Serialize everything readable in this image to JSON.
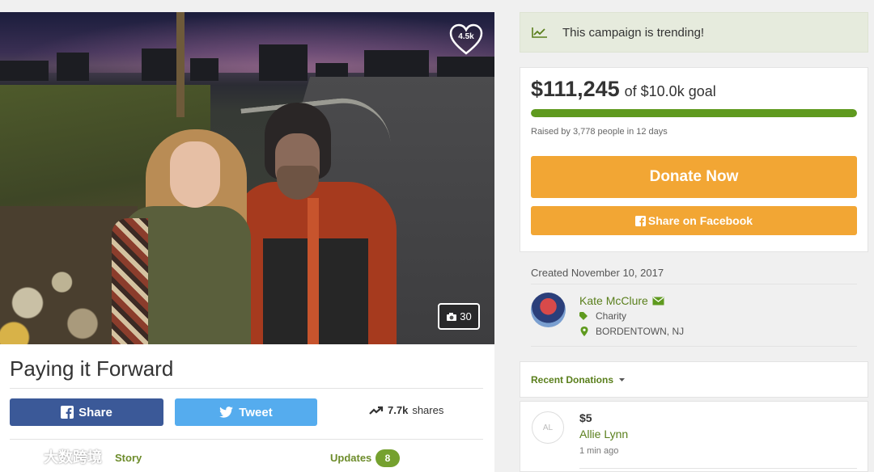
{
  "campaign": {
    "title": "Paying it Forward",
    "favorites_count": "4.5k",
    "photo_count": "30"
  },
  "social": {
    "share_label": "Share",
    "tweet_label": "Tweet",
    "shares_count": "7.7k",
    "shares_suffix": "shares"
  },
  "tabs": {
    "story_label": "Story",
    "updates_label": "Updates",
    "updates_count": "8"
  },
  "watermark": {
    "text": "大数跨境"
  },
  "trending": {
    "text": "This campaign is trending!"
  },
  "funding": {
    "raised": "$111,245",
    "goal": "of $10.0k goal",
    "progress_fraction": 1.0,
    "raised_by": "Raised by 3,778 people in 12 days"
  },
  "actions": {
    "donate_label": "Donate Now",
    "facebook_label": "Share on Facebook"
  },
  "organizer": {
    "created": "Created November 10, 2017",
    "name": "Kate McClure",
    "category": "Charity",
    "location": "BORDENTOWN, NJ"
  },
  "recent_donations": {
    "title": "Recent Donations",
    "items": [
      {
        "initials": "AL",
        "amount": "$5",
        "name": "Allie Lynn",
        "time": "1 min ago"
      }
    ]
  },
  "colors": {
    "accent_green": "#5f9a1f",
    "donate_orange": "#f2a634",
    "facebook_blue": "#3b5998",
    "twitter_blue": "#55acee"
  }
}
